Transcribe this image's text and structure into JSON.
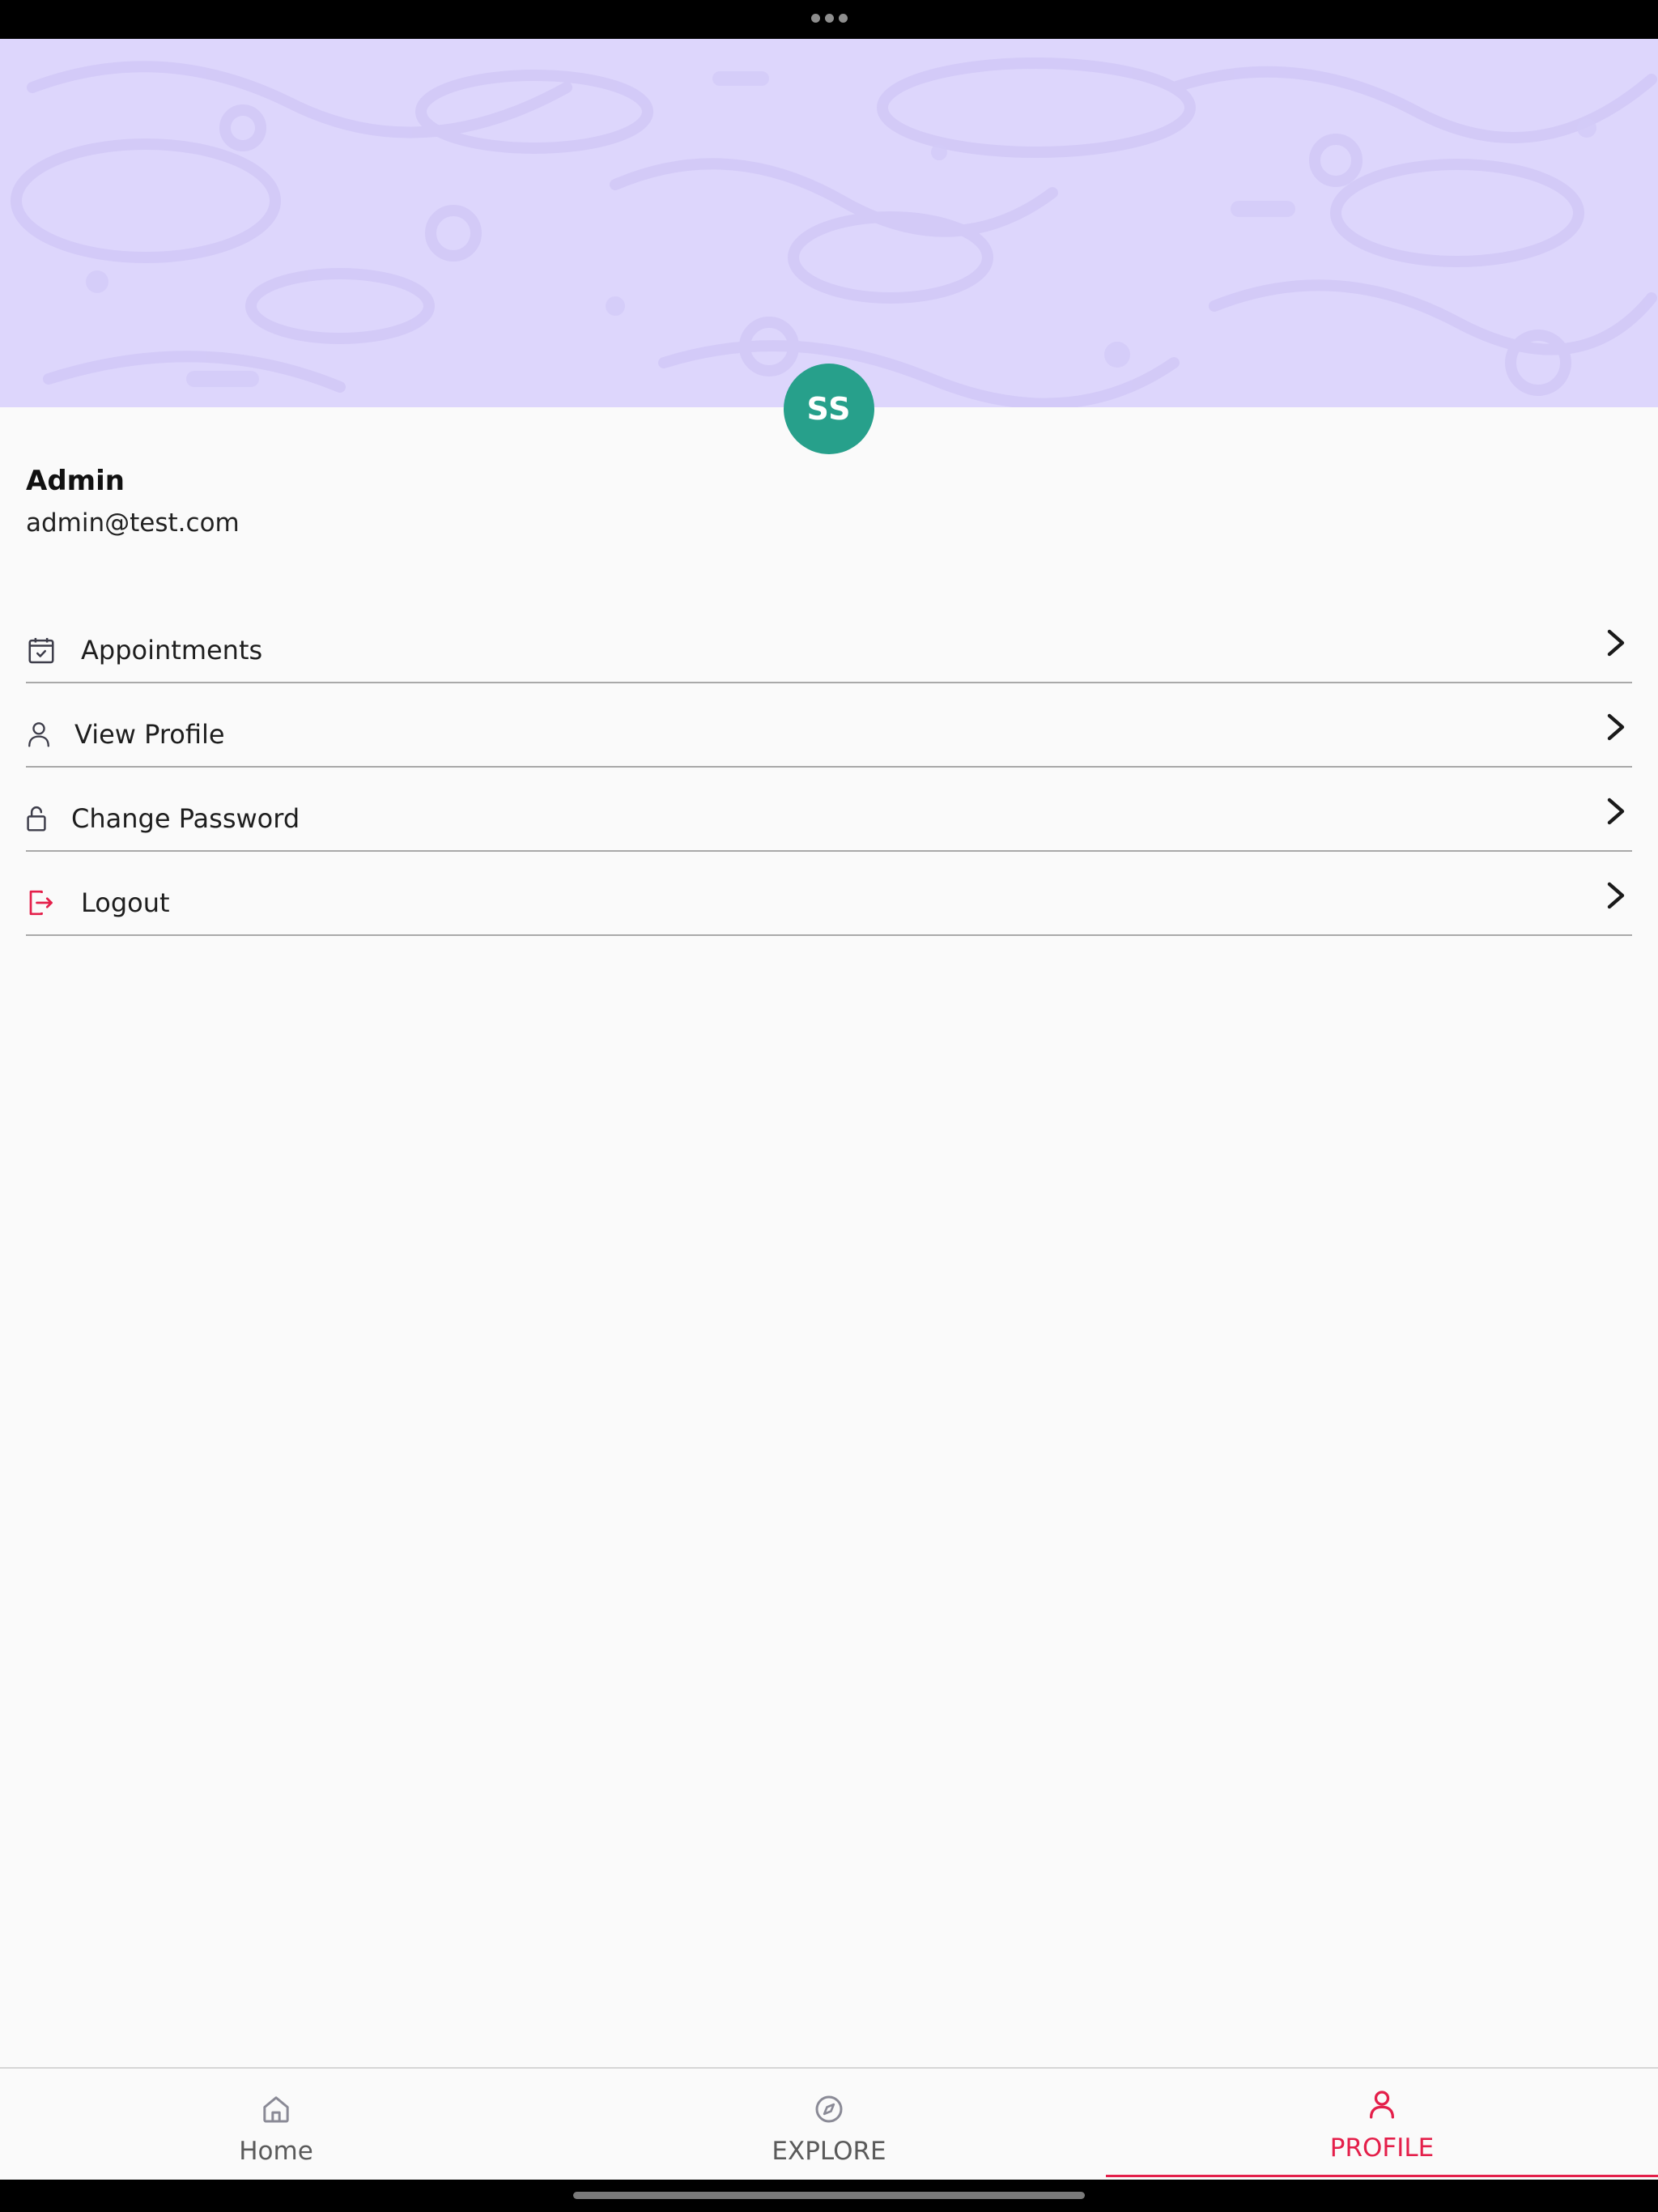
{
  "profile": {
    "avatar_initials": "SS",
    "name": "Admin",
    "email": "admin@test.com"
  },
  "menu": {
    "items": [
      {
        "label": "Appointments",
        "icon": "calendar-check-icon"
      },
      {
        "label": "View Profile",
        "icon": "user-icon"
      },
      {
        "label": "Change Password",
        "icon": "lock-icon"
      },
      {
        "label": "Logout",
        "icon": "logout-icon"
      }
    ]
  },
  "bottom_nav": {
    "items": [
      {
        "label": "Home",
        "icon": "home-icon",
        "active": false
      },
      {
        "label": "EXPLORE",
        "icon": "compass-icon",
        "active": false
      },
      {
        "label": "PROFILE",
        "icon": "user-icon",
        "active": true
      }
    ]
  },
  "colors": {
    "banner": "#ddd6fc",
    "avatar": "#27a08b",
    "accent": "#e41f4a",
    "background": "#fafafa"
  }
}
